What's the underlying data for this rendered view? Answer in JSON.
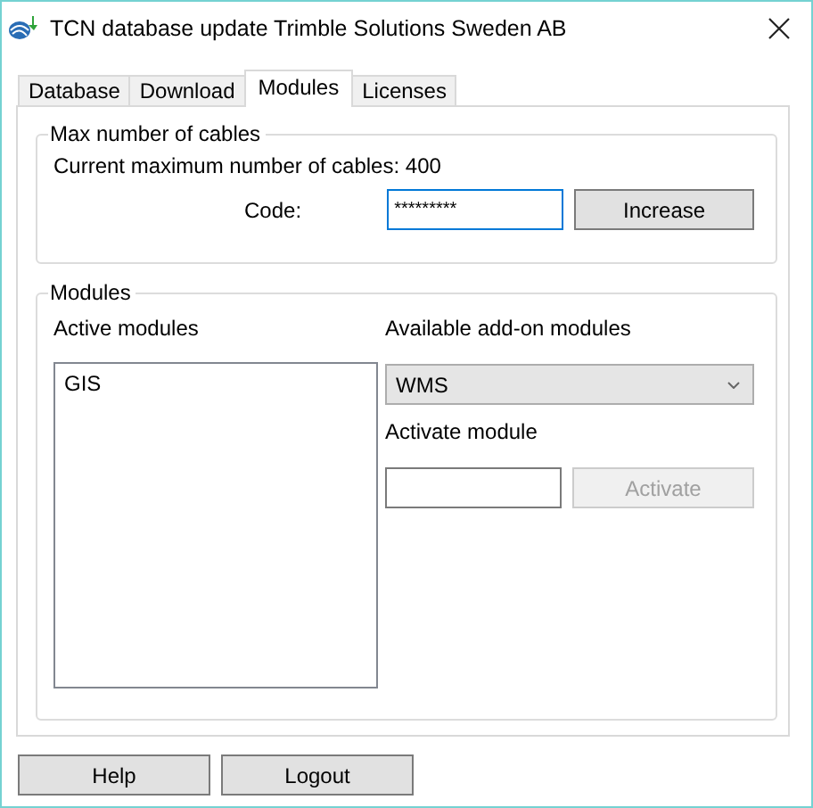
{
  "window": {
    "title": "TCN database update Trimble Solutions Sweden AB"
  },
  "tabs": [
    {
      "label": "Database",
      "selected": false
    },
    {
      "label": "Download",
      "selected": false
    },
    {
      "label": "Modules",
      "selected": true
    },
    {
      "label": "Licenses",
      "selected": false
    }
  ],
  "cables_group": {
    "title": "Max number of cables",
    "current": "Current maximum number of cables: 400",
    "code_label": "Code:",
    "code": {
      "value": "*********",
      "focused": true
    },
    "increase_button": {
      "label": "Increase",
      "disabled": false
    }
  },
  "modules_group": {
    "title": "Modules",
    "active_label": "Active modules",
    "active_modules": [
      {
        "name": "GIS",
        "selected": false
      }
    ],
    "available_label": "Available add-on modules",
    "available_select": "WMS",
    "activate_label": "Activate module",
    "activate_button": {
      "label": "Activate",
      "disabled": true
    }
  },
  "buttons": [
    "Help",
    "Logout"
  ]
}
